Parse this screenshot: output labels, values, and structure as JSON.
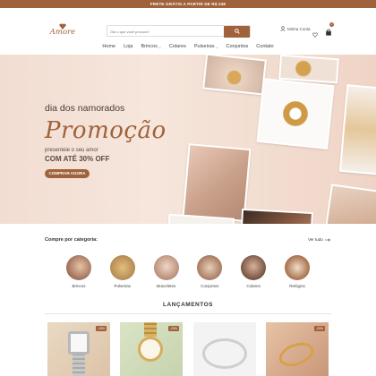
{
  "topbar": {
    "text": "FRETE GRÁTIS A PARTIR DE R$ 249"
  },
  "brand": {
    "name": "Amore",
    "color": "#a0623a"
  },
  "search": {
    "placeholder": "Olá o que você procura?",
    "icon": "search-icon"
  },
  "header": {
    "account_label": "Minha Conta",
    "cart_count": "0"
  },
  "nav": [
    {
      "label": "Home",
      "dropdown": false
    },
    {
      "label": "Loja",
      "dropdown": false
    },
    {
      "label": "Brincos",
      "dropdown": true
    },
    {
      "label": "Colares",
      "dropdown": false
    },
    {
      "label": "Pulseiras",
      "dropdown": true
    },
    {
      "label": "Conjuntos",
      "dropdown": false
    },
    {
      "label": "Contato",
      "dropdown": false
    }
  ],
  "hero": {
    "subtitle": "dia dos namorados",
    "title": "Promoção",
    "line1": "presenteie o seu amor",
    "line2": "COM ATÉ 30% OFF",
    "button": "COMPRAR AGORA"
  },
  "categories": {
    "title": "Compre por categoria:",
    "see_all": "Ver tudo",
    "items": [
      "Brincos",
      "Pulseiras",
      "Braceletes",
      "Conjuntos",
      "Colares",
      "Relógios"
    ]
  },
  "launches": {
    "title": "LANÇAMENTOS",
    "products": [
      {
        "badge": "-10%"
      },
      {
        "badge": "-20%"
      },
      {
        "badge": ""
      },
      {
        "badge": "-20%"
      }
    ]
  }
}
